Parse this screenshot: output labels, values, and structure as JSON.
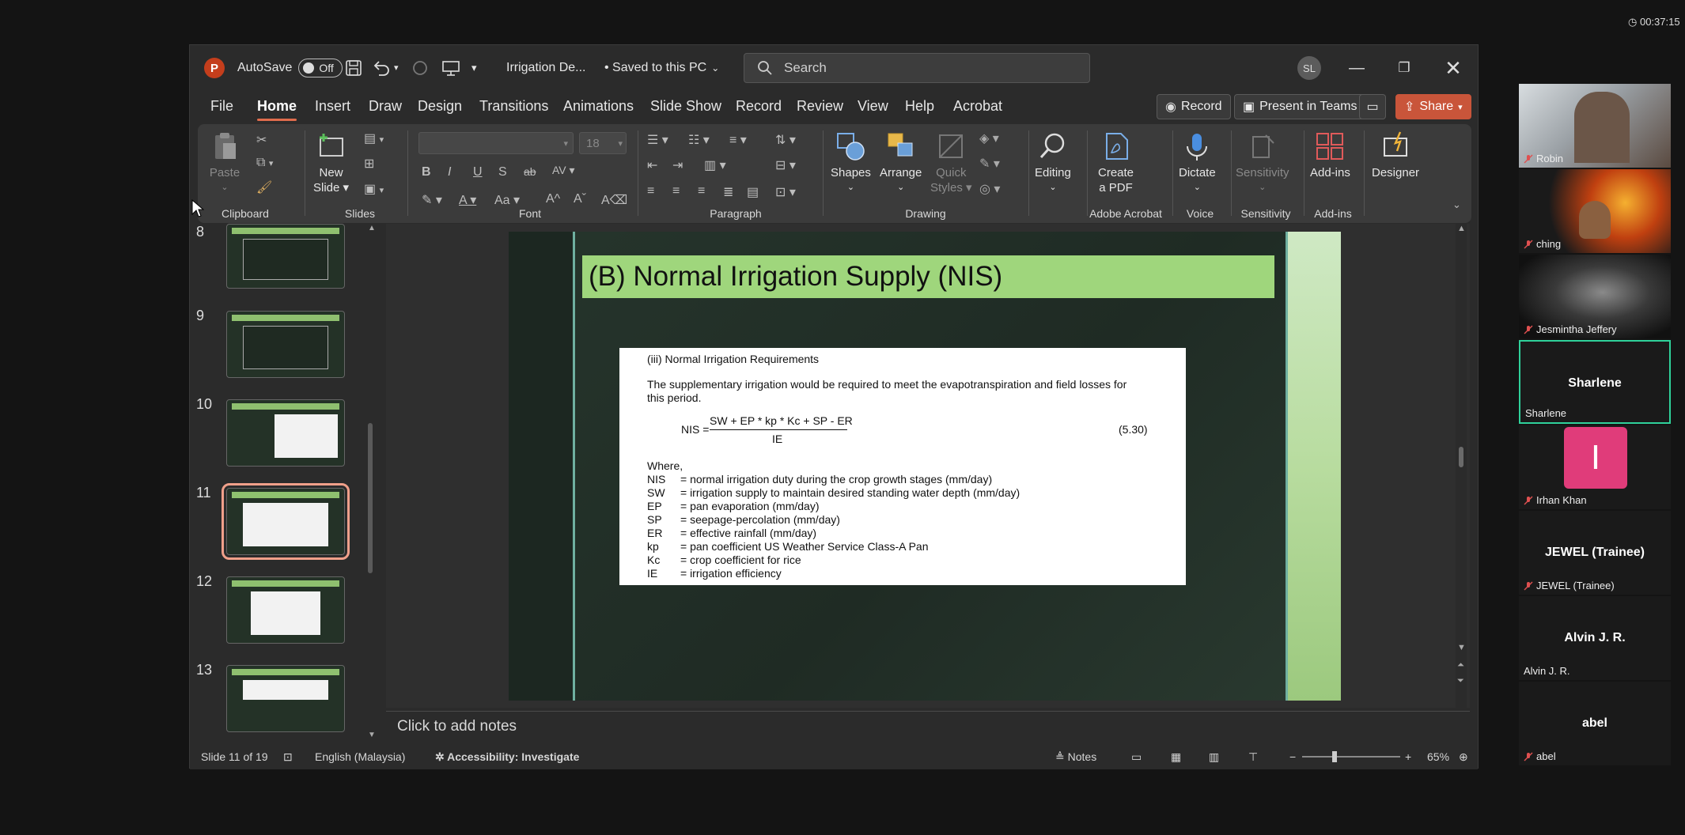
{
  "timer": "00:37:15",
  "window": {
    "app_logo": "P",
    "autosave_label": "AutoSave",
    "autosave_state": "Off",
    "doc_title": "Irrigation De...",
    "save_status": "• Saved to this PC",
    "search_placeholder": "Search",
    "user_initials": "SL"
  },
  "menu": {
    "tabs": [
      "File",
      "Home",
      "Insert",
      "Draw",
      "Design",
      "Transitions",
      "Animations",
      "Slide Show",
      "Record",
      "Review",
      "View",
      "Help",
      "Acrobat"
    ],
    "active": "Home",
    "record_label": "Record",
    "present_label": "Present in Teams",
    "share_label": "Share"
  },
  "ribbon": {
    "groups": {
      "clipboard": "Clipboard",
      "slides": "Slides",
      "font": "Font",
      "paragraph": "Paragraph",
      "drawing": "Drawing",
      "adobe": "Adobe Acrobat",
      "voice": "Voice",
      "sensitivity": "Sensitivity",
      "addins": "Add-ins"
    },
    "paste": "Paste",
    "new_slide_1": "New",
    "new_slide_2": "Slide",
    "font_size": "18",
    "shapes": "Shapes",
    "arrange": "Arrange",
    "quick_styles_1": "Quick",
    "quick_styles_2": "Styles",
    "editing": "Editing",
    "create_pdf_1": "Create",
    "create_pdf_2": "a PDF",
    "dictate": "Dictate",
    "sensitivity_btn": "Sensitivity",
    "addins_btn": "Add-ins",
    "designer": "Designer"
  },
  "thumbnails": [
    {
      "num": "8"
    },
    {
      "num": "9"
    },
    {
      "num": "10"
    },
    {
      "num": "11"
    },
    {
      "num": "12"
    },
    {
      "num": "13"
    }
  ],
  "slide": {
    "title": "(B) Normal Irrigation Supply (NIS)",
    "section": "(iii)     Normal Irrigation Requirements",
    "para1": "The supplementary irrigation would be required to meet the evapotranspiration and field losses for",
    "para2": "this period.",
    "eq_lhs": "NIS =",
    "eq_num": "SW + EP * kp * Kc + SP - ER",
    "eq_den": "IE",
    "eq_ref": "(5.30)",
    "where": "Where,",
    "defs": [
      {
        "k": "NIS",
        "v": "= normal irrigation duty during the crop growth stages (mm/day)"
      },
      {
        "k": "SW",
        "v": "= irrigation supply to maintain desired standing water depth (mm/day)"
      },
      {
        "k": "EP",
        "v": "= pan evaporation (mm/day)"
      },
      {
        "k": "SP",
        "v": "= seepage-percolation (mm/day)"
      },
      {
        "k": "ER",
        "v": "= effective rainfall (mm/day)"
      },
      {
        "k": "kp",
        "v": "= pan coefficient US Weather Service Class-A Pan"
      },
      {
        "k": "Kc",
        "v": "= crop coefficient for rice"
      },
      {
        "k": "IE",
        "v": "= irrigation efficiency"
      }
    ]
  },
  "notes_placeholder": "Click to add notes",
  "status": {
    "slide_info": "Slide 11 of 19",
    "language": "English (Malaysia)",
    "accessibility": "Accessibility: Investigate",
    "notes": "Notes",
    "zoom": "65%"
  },
  "participants": [
    {
      "name": "Robin",
      "muted": true
    },
    {
      "name": "ching",
      "muted": true
    },
    {
      "name": "Jesmintha Jeffery",
      "muted": true
    },
    {
      "name": "Sharlene",
      "center": "Sharlene",
      "muted": false
    },
    {
      "name": "Irhan Khan",
      "initial": "I",
      "muted": true
    },
    {
      "name": "JEWEL (Trainee)",
      "center": "JEWEL (Trainee)",
      "muted": true
    },
    {
      "name": "Alvin J. R.",
      "center": "Alvin J. R.",
      "muted": false
    },
    {
      "name": "abel",
      "center": "abel",
      "muted": true
    }
  ]
}
